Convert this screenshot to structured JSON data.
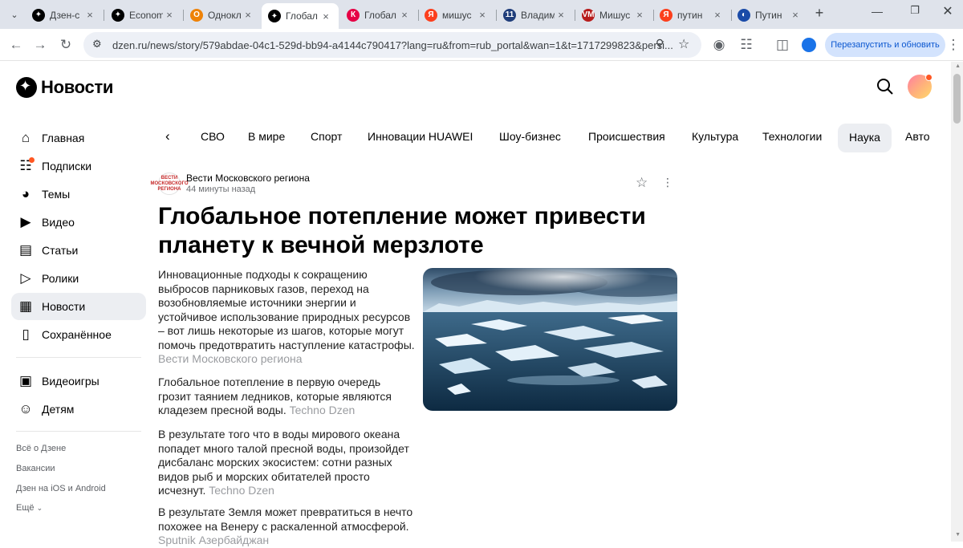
{
  "browser": {
    "tabs": [
      {
        "title": "Дзен-с",
        "color": "#000000",
        "glyph": "✦"
      },
      {
        "title": "Econom",
        "color": "#000000",
        "glyph": "✦"
      },
      {
        "title": "Однокл",
        "color": "#ee8208",
        "glyph": "О"
      },
      {
        "title": "Глобал",
        "color": "#000000",
        "glyph": "✦"
      },
      {
        "title": "Глобал",
        "color": "#e60045",
        "glyph": "К"
      },
      {
        "title": "мишус",
        "color": "#fc3f1d",
        "glyph": "Я"
      },
      {
        "title": "Владим",
        "color": "#1f3d7a",
        "glyph": "11"
      },
      {
        "title": "Мишус",
        "color": "#b71c1c",
        "glyph": "VM"
      },
      {
        "title": "путин",
        "color": "#fc3f1d",
        "glyph": "Я"
      },
      {
        "title": "Путин",
        "color": "#1a4ba8",
        "glyph": "◐"
      }
    ],
    "url": "dzen.ru/news/story/579abdae-04c1-529d-bb94-a4144c790417?lang=ru&from=rub_portal&wan=1&t=1717299823&persi...",
    "relaunch_label": "Перезапустить и обновить"
  },
  "site": {
    "logo_text": "Новости"
  },
  "sidebar": {
    "items": [
      {
        "label": "Главная",
        "icon": "home-icon"
      },
      {
        "label": "Подписки",
        "icon": "subscriptions-icon"
      },
      {
        "label": "Темы",
        "icon": "compass-icon"
      },
      {
        "label": "Видео",
        "icon": "video-icon"
      },
      {
        "label": "Статьи",
        "icon": "book-icon"
      },
      {
        "label": "Ролики",
        "icon": "play-icon"
      },
      {
        "label": "Новости",
        "icon": "news-icon"
      },
      {
        "label": "Сохранённое",
        "icon": "bookmark-icon"
      },
      {
        "label": "Видеоигры",
        "icon": "gamepad-icon"
      },
      {
        "label": "Детям",
        "icon": "kids-icon"
      }
    ],
    "footer_links": [
      "Всё о Дзене",
      "Вакансии",
      "Дзен на iOS и Android",
      "Ещё"
    ]
  },
  "categories": [
    "СВО",
    "В мире",
    "Спорт",
    "Инновации HUAWEI",
    "Шоу-бизнес",
    "Происшествия",
    "Культура",
    "Технологии",
    "Наука",
    "Авто"
  ],
  "article": {
    "source_name": "Вести Московского региона",
    "source_logo_text": "ВЕСТИ МОСКОВСКОГО РЕГИОНА",
    "time": "44 минуты назад",
    "headline": "Глобальное потепление может привести планету к вечной мерзлоте",
    "paragraphs": [
      {
        "text": "Инновационные подходы к сокращению выбросов парниковых газов, переход на возобновляемые источники энергии и устойчивое использование природных ресурсов – вот лишь некоторые из шагов, которые могут помочь предотвратить наступление катастрофы.",
        "source": "Вести Московского региона"
      },
      {
        "text": "Глобальное потепление в первую очередь грозит таянием ледников, которые являются кладезем пресной воды.",
        "source": "Techno Dzen"
      },
      {
        "text": "В результате того что в воды мирового океана попадет много талой пресной воды, произойдет дисбаланс морских экосистем: сотни разных видов рыб и морских обитателей просто исчезнут.",
        "source": "Techno Dzen"
      },
      {
        "text": "В результате Земля может превратиться в нечто похожее на Венеру с раскаленной атмосферой.",
        "source": "Sputnik Азербайджан"
      }
    ]
  }
}
